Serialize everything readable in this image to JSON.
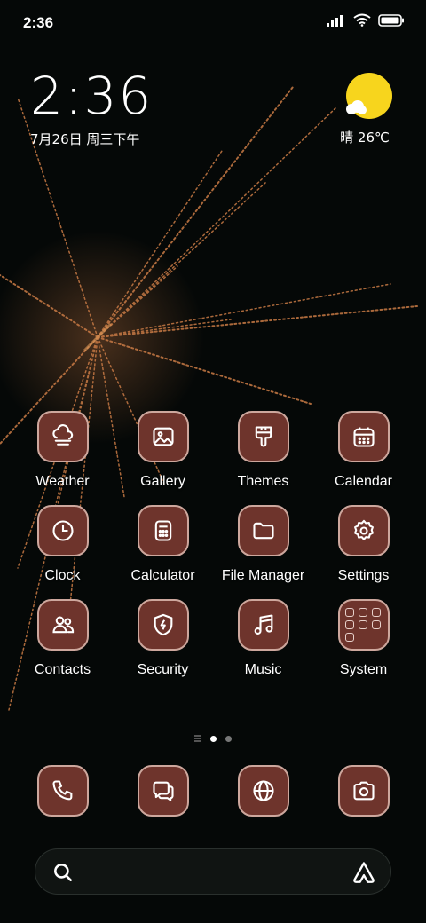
{
  "status_bar": {
    "time": "2:36",
    "icons": [
      "signal-icon",
      "wifi-icon",
      "battery-icon"
    ]
  },
  "clock_widget": {
    "time": "2:36",
    "date": "7月26日 周三下午"
  },
  "weather_widget": {
    "icon": "sun-cloud-icon",
    "text": "晴 26℃",
    "sun_color": "#f7d51d"
  },
  "apps": [
    {
      "label": "Weather",
      "icon": "weather-icon"
    },
    {
      "label": "Gallery",
      "icon": "gallery-icon"
    },
    {
      "label": "Themes",
      "icon": "themes-icon"
    },
    {
      "label": "Calendar",
      "icon": "calendar-icon"
    },
    {
      "label": "Clock",
      "icon": "clock-icon"
    },
    {
      "label": "Calculator",
      "icon": "calculator-icon"
    },
    {
      "label": "File Manager",
      "icon": "folder-icon"
    },
    {
      "label": "Settings",
      "icon": "gear-icon"
    },
    {
      "label": "Contacts",
      "icon": "contacts-icon"
    },
    {
      "label": "Security",
      "icon": "shield-icon"
    },
    {
      "label": "Music",
      "icon": "music-icon"
    },
    {
      "label": "System",
      "icon": "folder-grid-icon"
    }
  ],
  "page_indicator": {
    "pages": 2,
    "active_page": 1
  },
  "dock": [
    {
      "icon": "phone-icon"
    },
    {
      "icon": "messages-icon"
    },
    {
      "icon": "browser-icon"
    },
    {
      "icon": "camera-icon"
    }
  ],
  "search_bar": {
    "left_icon": "search-icon",
    "right_icon": "assistant-icon"
  },
  "colors": {
    "icon_fill": "#6e342c",
    "icon_border": "#cda79d",
    "background": "#050807",
    "firework": "#c87a45"
  }
}
